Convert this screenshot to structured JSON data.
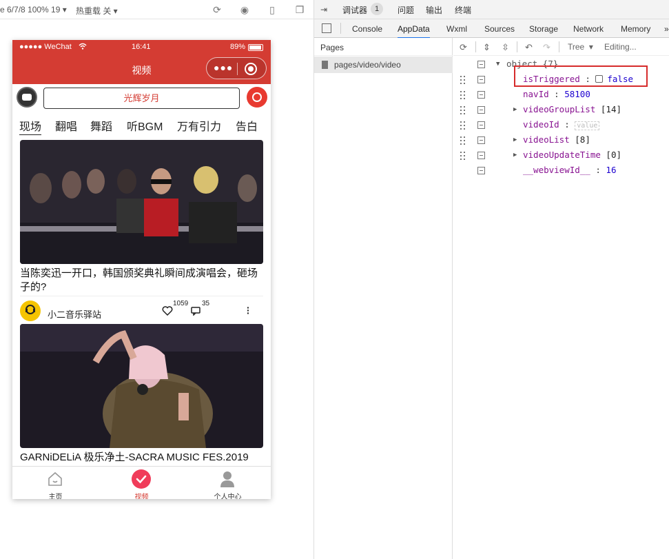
{
  "simulator": {
    "toolbar": {
      "info": "e 6/7/8 100% 19",
      "hotreload": "热重载 关"
    },
    "phone": {
      "statusbar": {
        "carrier": "●●●●● WeChat",
        "time": "16:41",
        "battery": "89%"
      },
      "navbar": {
        "title": "视频"
      },
      "search": {
        "placeholder": "光辉岁月"
      },
      "category_tabs": [
        "现场",
        "翻唱",
        "舞蹈",
        "听BGM",
        "万有引力",
        "告白"
      ],
      "videos": [
        {
          "title": "当陈奕迅一开口，韩国颁奖典礼瞬间成演唱会，砸场子的?",
          "author": "小二音乐驿站",
          "likes": "1059",
          "comments": "35"
        },
        {
          "title": "GARNiDELiA 极乐净土-SACRA MUSIC FES.2019"
        }
      ],
      "tabbar": [
        {
          "label": "主页",
          "icon": "home-icon"
        },
        {
          "label": "视频",
          "icon": "check-circle-icon"
        },
        {
          "label": "个人中心",
          "icon": "person-icon"
        }
      ]
    }
  },
  "devtools": {
    "top": {
      "debugger": "调试器",
      "badge": "1",
      "issues": "问题",
      "output": "输出",
      "terminal": "终端"
    },
    "tabs": [
      "Console",
      "AppData",
      "Wxml",
      "Sources",
      "Storage",
      "Network",
      "Memory"
    ],
    "active_tab": "AppData",
    "pages": {
      "header": "Pages",
      "item": "pages/video/video"
    },
    "toolbar": {
      "view_mode": "Tree",
      "status": "Editing..."
    },
    "appdata": {
      "root": "object {7}",
      "rows": [
        {
          "key": "isTriggered",
          "sep": " : ",
          "value": "false",
          "type": "bool"
        },
        {
          "key": "navId",
          "sep": " : ",
          "value": "58100",
          "type": "num"
        },
        {
          "key": "videoGroupList",
          "sep": " ",
          "value": "[14]",
          "type": "arr"
        },
        {
          "key": "videoId",
          "sep": " : ",
          "value": "value",
          "type": "str"
        },
        {
          "key": "videoList",
          "sep": " ",
          "value": "[8]",
          "type": "arr"
        },
        {
          "key": "videoUpdateTime",
          "sep": " ",
          "value": "[0]",
          "type": "arr"
        },
        {
          "key": "__webviewId__",
          "sep": " : ",
          "value": "16",
          "type": "num"
        }
      ]
    },
    "colors": {
      "highlight_border": "#d62b2b",
      "brand_red": "#d43c33"
    }
  }
}
